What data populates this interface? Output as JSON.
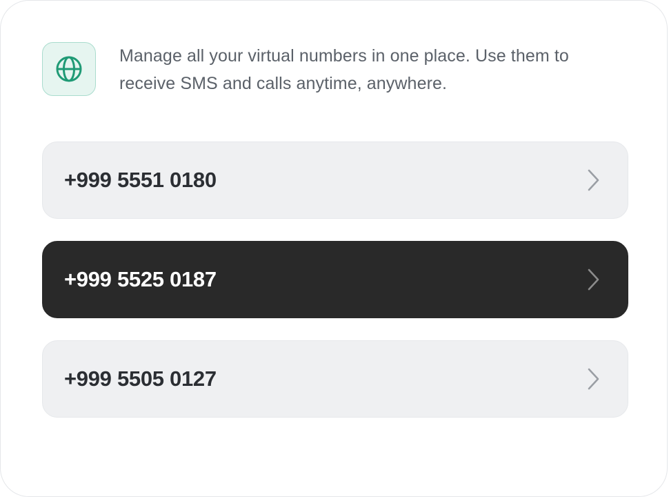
{
  "header": {
    "description": "Manage all your virtual numbers in one place. Use them to receive SMS and calls anytime, anywhere.",
    "icon": "globe-icon",
    "accent_color": "#1f9a75"
  },
  "numbers": [
    {
      "value": "+999 5551 0180",
      "selected": false
    },
    {
      "value": "+999 5525 0187",
      "selected": true
    },
    {
      "value": "+999 5505 0127",
      "selected": false
    }
  ],
  "row_icon": "chevron-right-icon",
  "colors": {
    "selected_bg": "#292929",
    "row_bg": "#eff0f2"
  }
}
